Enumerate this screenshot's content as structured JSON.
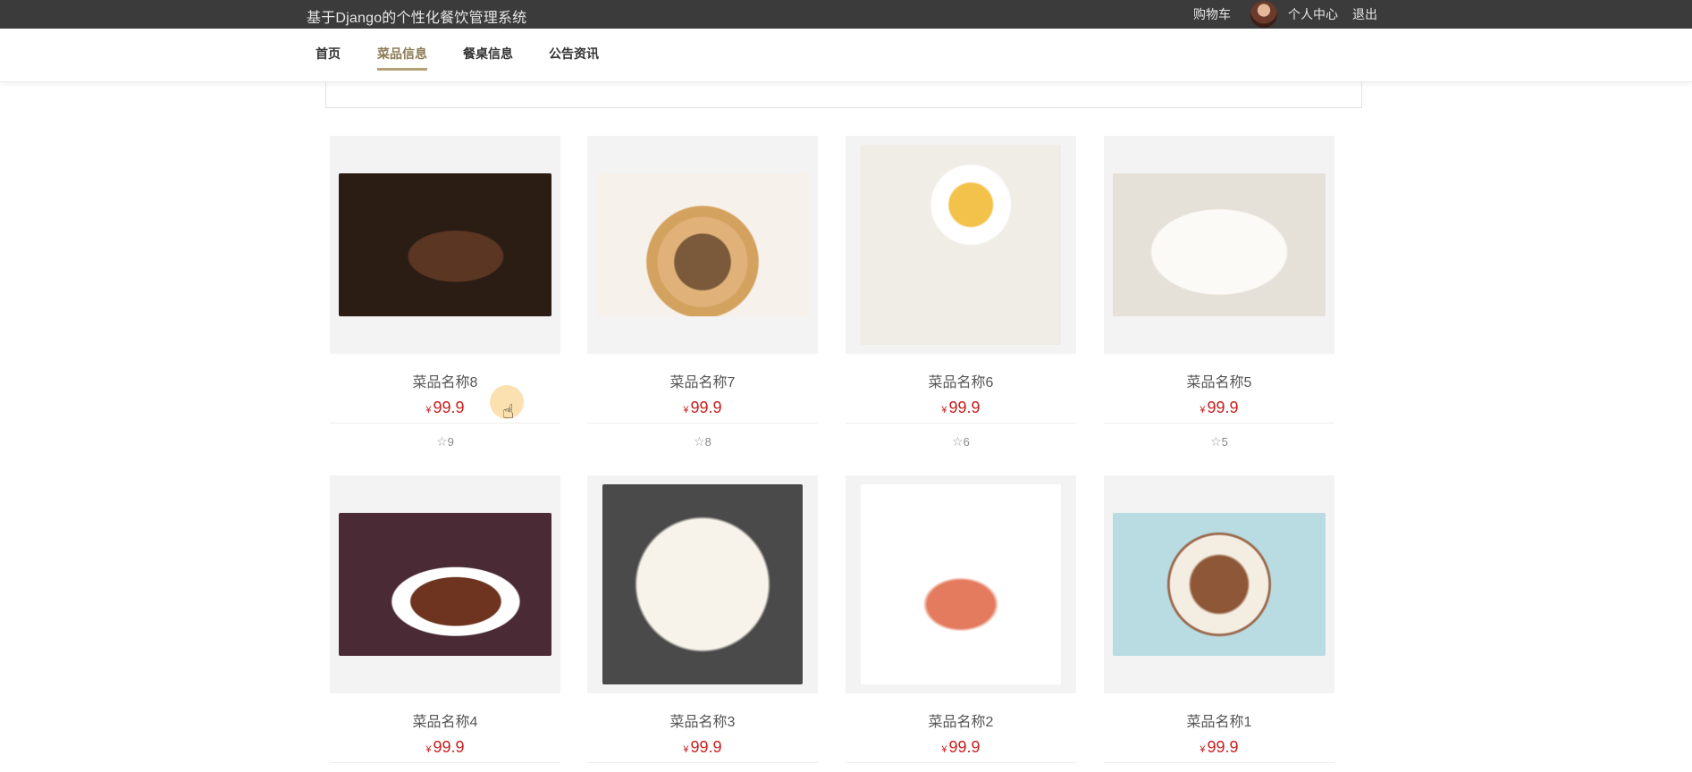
{
  "header": {
    "site_title": "基于Django的个性化餐饮管理系统",
    "cart_label": "购物车",
    "profile_label": "个人中心",
    "logout_label": "退出"
  },
  "nav": {
    "items": [
      {
        "label": "首页",
        "active": false
      },
      {
        "label": "菜品信息",
        "active": true
      },
      {
        "label": "餐桌信息",
        "active": false
      },
      {
        "label": "公告资讯",
        "active": false
      }
    ]
  },
  "currency_symbol": "¥",
  "products": [
    {
      "name": "菜品名称8",
      "price": "99.9",
      "favorites": "9"
    },
    {
      "name": "菜品名称7",
      "price": "99.9",
      "favorites": "8"
    },
    {
      "name": "菜品名称6",
      "price": "99.9",
      "favorites": "6"
    },
    {
      "name": "菜品名称5",
      "price": "99.9",
      "favorites": "5"
    },
    {
      "name": "菜品名称4",
      "price": "99.9"
    },
    {
      "name": "菜品名称3",
      "price": "99.9"
    },
    {
      "name": "菜品名称2",
      "price": "99.9"
    },
    {
      "name": "菜品名称1",
      "price": "99.9"
    }
  ],
  "colors": {
    "topbar": "#3b3b3b",
    "nav_active": "#8c7a55",
    "nav_underline": "#b59f74",
    "price": "#c81e1e"
  },
  "icons": {
    "favorite": "star-outline-icon",
    "cursor": "hand-pointer-icon"
  }
}
